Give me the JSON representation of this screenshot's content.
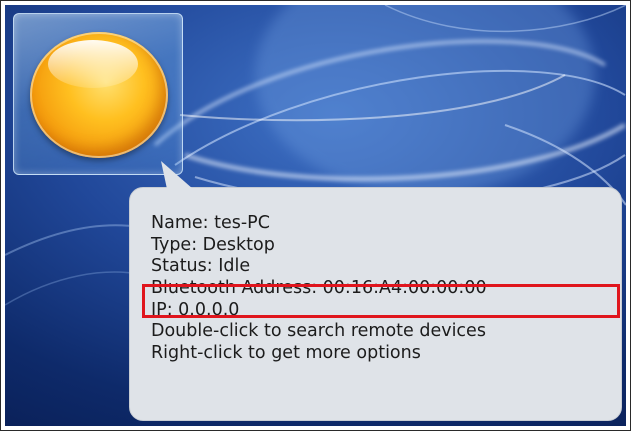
{
  "tooltip": {
    "name_line": "Name: tes-PC",
    "type_line": "Type: Desktop",
    "status_line": "Status: Idle",
    "bluetooth_address_line": "Bluetooth Address: 00:16:A4:00:00:00",
    "ip_line": "IP: 0.0.0.0",
    "hint_double_click": "Double-click to search remote devices",
    "hint_right_click": "Right-click to get more options"
  },
  "device": {
    "icon": "desktop-sun-icon"
  },
  "colors": {
    "background": "#21489a",
    "tooltip_fill": "#dfe3e8",
    "highlight": "#e0151d",
    "icon_orange": "#f49a0c"
  }
}
